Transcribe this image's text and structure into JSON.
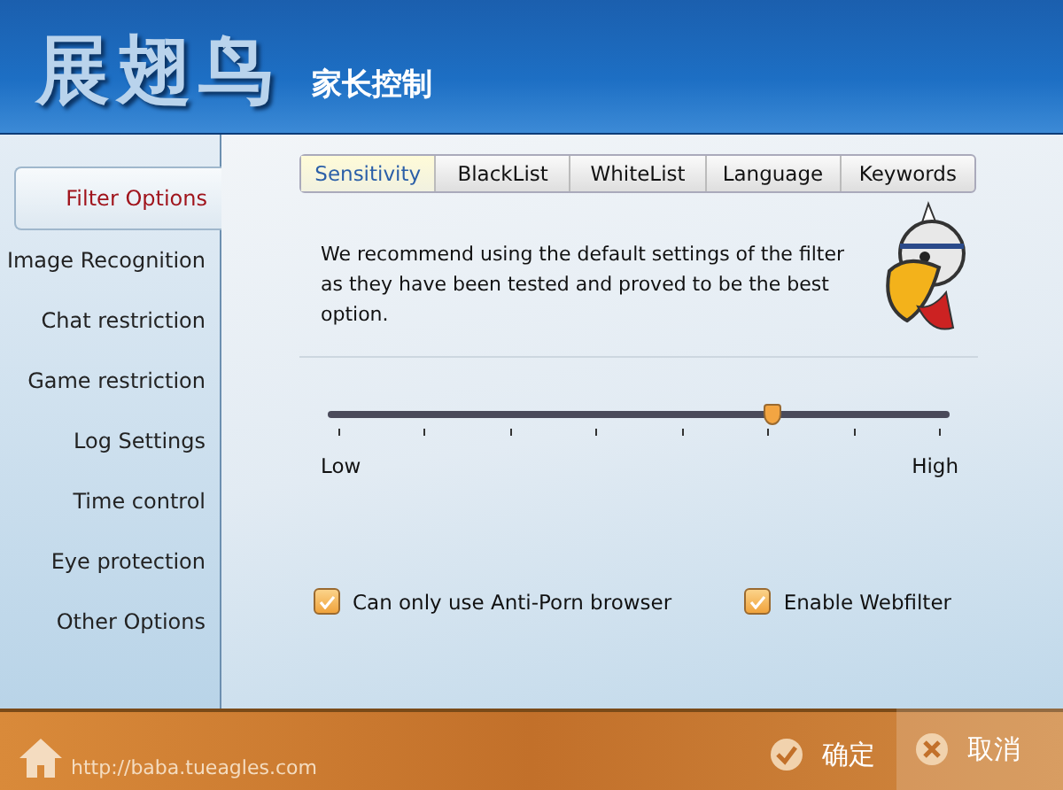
{
  "header": {
    "logo": "展翅鸟",
    "subtitle": "家长控制"
  },
  "sidebar": {
    "items": [
      {
        "label": "Filter Options",
        "selected": true
      },
      {
        "label": "Image Recognition",
        "selected": false
      },
      {
        "label": "Chat restriction",
        "selected": false
      },
      {
        "label": "Game restriction",
        "selected": false
      },
      {
        "label": "Log Settings",
        "selected": false
      },
      {
        "label": "Time control",
        "selected": false
      },
      {
        "label": "Eye protection",
        "selected": false
      },
      {
        "label": "Other Options",
        "selected": false
      }
    ]
  },
  "tabs": [
    {
      "label": "Sensitivity",
      "selected": true
    },
    {
      "label": "BlackList",
      "selected": false
    },
    {
      "label": "WhiteList",
      "selected": false
    },
    {
      "label": "Language",
      "selected": false
    },
    {
      "label": "Keywords",
      "selected": false
    }
  ],
  "description": "We recommend using the default settings of the filter as they have been tested and proved to be the best option.",
  "slider": {
    "level": 0.714,
    "min_label": "Low",
    "max_label": "High"
  },
  "checkboxes": [
    {
      "label": "Can only use Anti-Porn browser",
      "checked": true
    },
    {
      "label": "Enable Webfilter",
      "checked": true
    }
  ],
  "footer": {
    "url": "http://baba.tueagles.com",
    "ok": "确定",
    "cancel": "取消"
  }
}
